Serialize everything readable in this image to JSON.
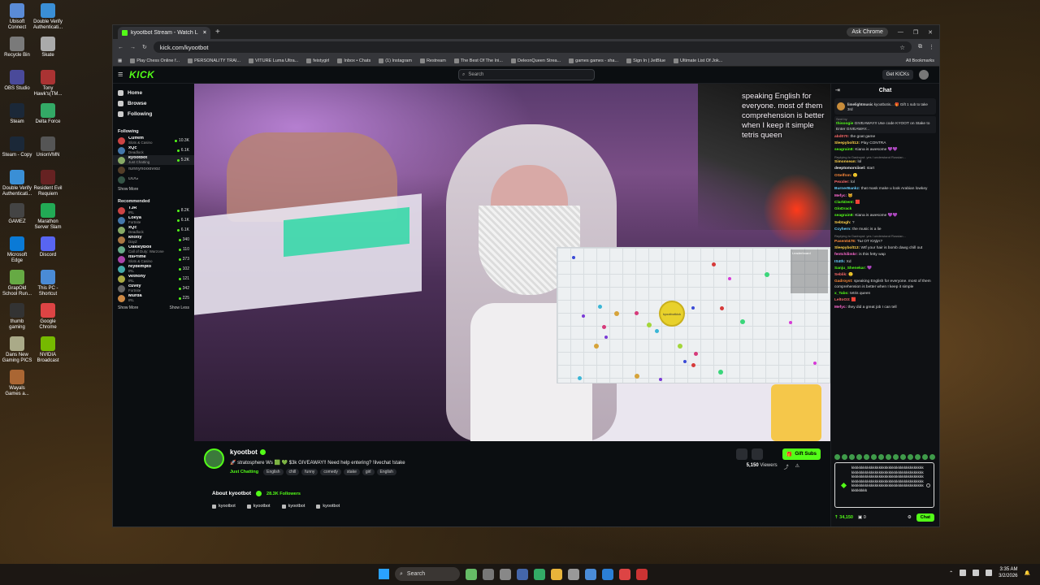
{
  "desktop": {
    "icons": [
      "Ubisoft Connect",
      "Double Verify Authenticati...",
      "Recycle Bin",
      "Skate",
      "OBS Studio",
      "Tony Hawk's(TM...",
      "Steam",
      "Delta Force",
      "Steam - Copy",
      "UnionVMN",
      "Double Verify Authenticati...",
      "Resident Evil Requiem",
      "GAMEZ",
      "Marathon Server Slam",
      "Microsoft Edge",
      "Discord",
      "GrapOld School Run...",
      "This PC - Shortcut",
      "thumb gaming",
      "Google Chrome",
      "Dans New Gaming PICS",
      "NVIDIA Broadcast",
      "Wayals Games a..."
    ]
  },
  "browser": {
    "tab_title": "kyootbot Stream - Watch L",
    "new_tab": "+",
    "ask_chrome": "Ask Chrome",
    "url": "kick.com/kyootbot",
    "bookmarks": [
      "Play Chess Online f...",
      "PERSONALITY TRAI...",
      "VITURE Luma Ultra...",
      "feistygirl",
      "Inbox • Chats",
      "(1) Instagram",
      "Restream",
      "The Best Of The Ini...",
      "DeleonQueen Strea...",
      "games games - sha...",
      "Sign In | JetBlue",
      "Ultimate List Of Jok..."
    ],
    "all_bookmarks": "All Bookmarks"
  },
  "kick": {
    "logo": "KICK",
    "search_placeholder": "Search",
    "get_kicks": "Get KICKs",
    "nav": {
      "home": "Home",
      "browse": "Browse",
      "following": "Following"
    },
    "following_title": "Following",
    "following": [
      {
        "name": "Cuffem",
        "cat": "Slots & Casino",
        "viewers": "10.3K"
      },
      {
        "name": "xQc",
        "cat": "Deadlock",
        "viewers": "6.1K"
      },
      {
        "name": "kyootbot",
        "cat": "Just Chatting",
        "viewers": "5.2K"
      },
      {
        "name": "funnyhoodvidz",
        "cat": "",
        "viewers": ""
      },
      {
        "name": "DDG",
        "cat": "",
        "viewers": ""
      }
    ],
    "show_more": "Show More",
    "recommended_title": "Recommended",
    "recommended": [
      {
        "name": "TJR",
        "cat": "IRL",
        "viewers": "8.2K"
      },
      {
        "name": "Loeya",
        "cat": "Fortnite",
        "viewers": "6.1K"
      },
      {
        "name": "xQc",
        "cat": "Deadlock",
        "viewers": "6.1K"
      },
      {
        "name": "knotty",
        "cat": "DayZ",
        "viewers": "340"
      },
      {
        "name": "OakleyBoll",
        "cat": "Call of Duty: Warzone",
        "viewers": "110"
      },
      {
        "name": "ItsPrime",
        "cat": "Slots & Casino",
        "viewers": "373"
      },
      {
        "name": "reydempto",
        "cat": "IRL",
        "viewers": "102"
      },
      {
        "name": "vethony",
        "cat": "IRL",
        "viewers": "121"
      },
      {
        "name": "cuvey",
        "cat": "Fortnite",
        "viewers": "342"
      },
      {
        "name": "Murda",
        "cat": "IRL",
        "viewers": "225"
      }
    ],
    "show_less": "Show Less"
  },
  "video": {
    "caption": "speaking English for everyone. most of them comprehension is better when I keep it simple tetris queen",
    "leaderboard": "Leaderboard",
    "player_name": "kyootbotkick"
  },
  "stream": {
    "streamer": "kyootbot",
    "title": "🚀 stratosphere Ws 🟩 💚 $3k GIVEAWAY!! Need help entering? !livechat !stake",
    "category": "Just Chatting",
    "tags": [
      "English",
      "chill",
      "funny",
      "comedy",
      "stake",
      "girl",
      "English"
    ],
    "gift_subs": "Gift Subs",
    "viewers": "5,150",
    "viewers_label": "Viewers",
    "about": "About kyootbot",
    "followers": "28.3K",
    "followers_label": "Followers",
    "socials": [
      "kyootbot",
      "kyootbot",
      "kyootbot",
      "kyootbot"
    ]
  },
  "chat": {
    "title": "Chat",
    "pinned": {
      "user": "limelightmusic",
      "text": "kyootbotis... 🎁 Gift 1 sub to take 3rd"
    },
    "messages": [
      {
        "user": "thisoogie",
        "text": "GIVEAWAY!! Use code KYOOT on Stake to Enter GIVEAWAY...",
        "color": "#53fc18",
        "reply": "Sent by",
        "pin": true
      },
      {
        "user": "abd070:",
        "text": "the goat game",
        "color": "#ff6a6a"
      },
      {
        "user": "Sleepybolt13:",
        "text": "Play CONTRA",
        "color": "#ffd24a"
      },
      {
        "user": "seagrain8:",
        "text": "Kiana is awesome 💜💜",
        "color": "#53fc18"
      },
      {
        "user": "Simonsean:",
        "text": "lol",
        "color": "#ffd24a",
        "reply": "Replying to Dadroyst: yes I understand Russian..."
      },
      {
        "user": "deeptomorsiisel:",
        "text": "start",
        "color": "#eee"
      },
      {
        "user": "OSelfnm:",
        "text": "🙂",
        "color": "#ff8a3a"
      },
      {
        "user": "Pexxler:",
        "text": "lol",
        "color": "#ff6a6a"
      },
      {
        "user": "BurnerBankz:",
        "text": "that mask make u look Arabian lowkey",
        "color": "#6ad0ff"
      },
      {
        "user": "Mefyc:",
        "text": "🐱",
        "color": "#ff6ad0"
      },
      {
        "user": "ClarkDent:",
        "text": "🟥",
        "color": "#53fc18"
      },
      {
        "user": "GloDrack",
        "text": "",
        "color": "#53fc18"
      },
      {
        "user": "seagrain8:",
        "text": "Kiana is awesome 💜💜",
        "color": "#53fc18"
      },
      {
        "user": "Sebtagh:",
        "text": "?",
        "color": "#ffd24a"
      },
      {
        "user": "Ccyhern:",
        "text": "the music is a lie",
        "color": "#6ad0ff"
      },
      {
        "user": "Pasen0478:",
        "text": "ТЫ ОТ КУДА?",
        "color": "#ff8a3a",
        "reply": "Replying to Dadroyst: yes I understand Russian..."
      },
      {
        "user": "Sleepybolt13:",
        "text": "Wtf your hair is bomb dawg chill out",
        "color": "#ffd24a"
      },
      {
        "user": "fentchilimkr:",
        "text": "is this fetty wap",
        "color": "#ff6ad0"
      },
      {
        "user": "IS4th:",
        "text": "Xd",
        "color": "#6ad0ff"
      },
      {
        "user": "Sanju_Shenekar:",
        "text": "💜",
        "color": "#53fc18"
      },
      {
        "user": "Seblik:",
        "text": "🙂",
        "color": "#ff6a6a"
      },
      {
        "user": "Gadroyst:",
        "text": "speaking English for everyone. most of them comprehension is better when I keep it simple",
        "color": "#ff8a3a"
      },
      {
        "user": "x_Tabs:",
        "text": "tetris queen",
        "color": "#53fc18"
      },
      {
        "user": "LeltoO3:",
        "text": "🟥",
        "color": "#ff6a6a"
      },
      {
        "user": "Mefyc:",
        "text": "they did a great job I can tell",
        "color": "#ff6ad0"
      }
    ],
    "input_text": "kkkkkkkkkkkkkkkkkkkkkkkkkkkkkkkkkkkkkkkkkkkkkkkkkkkkkkkkkkkkkkkkkkkkkkkkkkkkkkkkkkkkkkkkkkkkkkkkkkkkkkkkkkkkkkkkkkkkkkkkkkkkkkkkkkkkkkkkkkkkkkkkkkkkkkkkkkkkkkkkkkkkkkkkkkkkkkkkkkkkkkkkkkkkkkkkk",
    "points": "34,150",
    "other_count": "0",
    "send": "Chat"
  },
  "taskbar": {
    "search": "Search",
    "time": "3:35 AM",
    "date": "3/2/2026"
  }
}
